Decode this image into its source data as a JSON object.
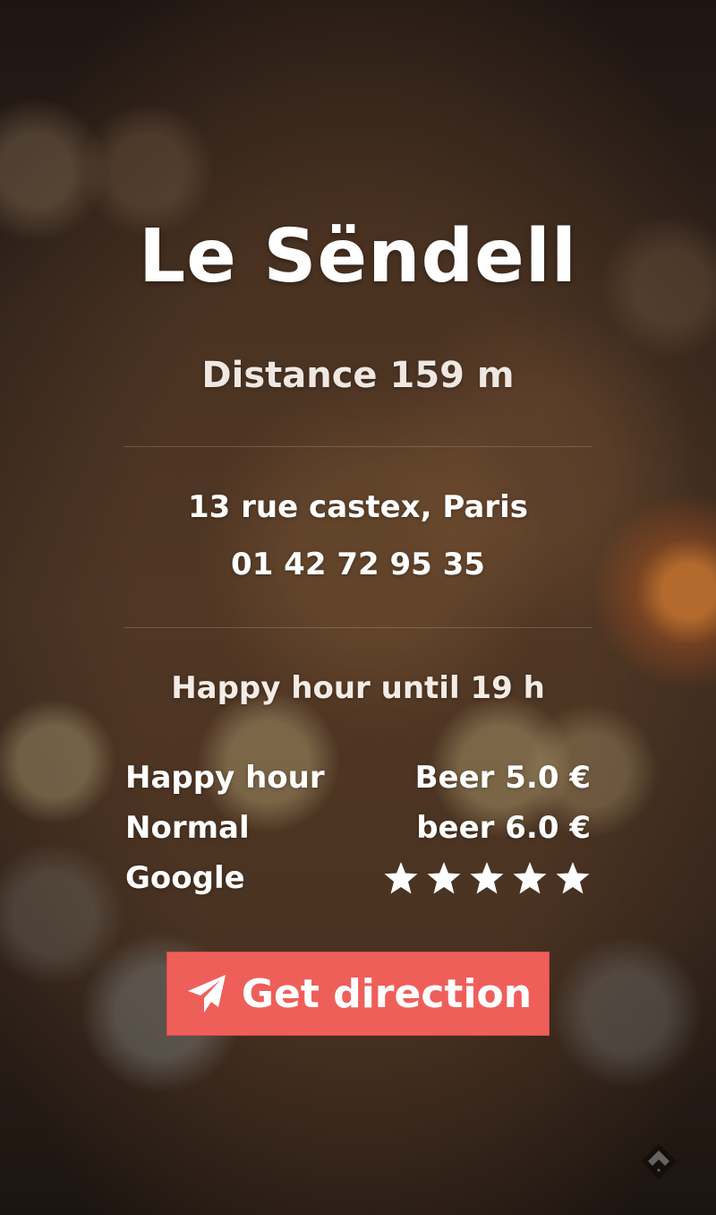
{
  "venue": {
    "name": "Le Sëndell",
    "distance": "Distance 159 m",
    "address": "13 rue castex, Paris",
    "phone": "01 42 72 95 35",
    "happy_hour_until": "Happy hour until 19 h"
  },
  "prices": [
    {
      "label": "Happy hour",
      "value": "Beer 5.0 €"
    },
    {
      "label": "Normal",
      "value": "beer 6.0 €"
    }
  ],
  "rating": {
    "label": "Google",
    "stars": 5,
    "max": 5
  },
  "action": {
    "direction_label": "Get direction",
    "icon": "paper-plane-icon"
  },
  "colors": {
    "button": "#ef5f5a",
    "text": "#ffffff"
  },
  "footer_icon": "feedly-icon"
}
